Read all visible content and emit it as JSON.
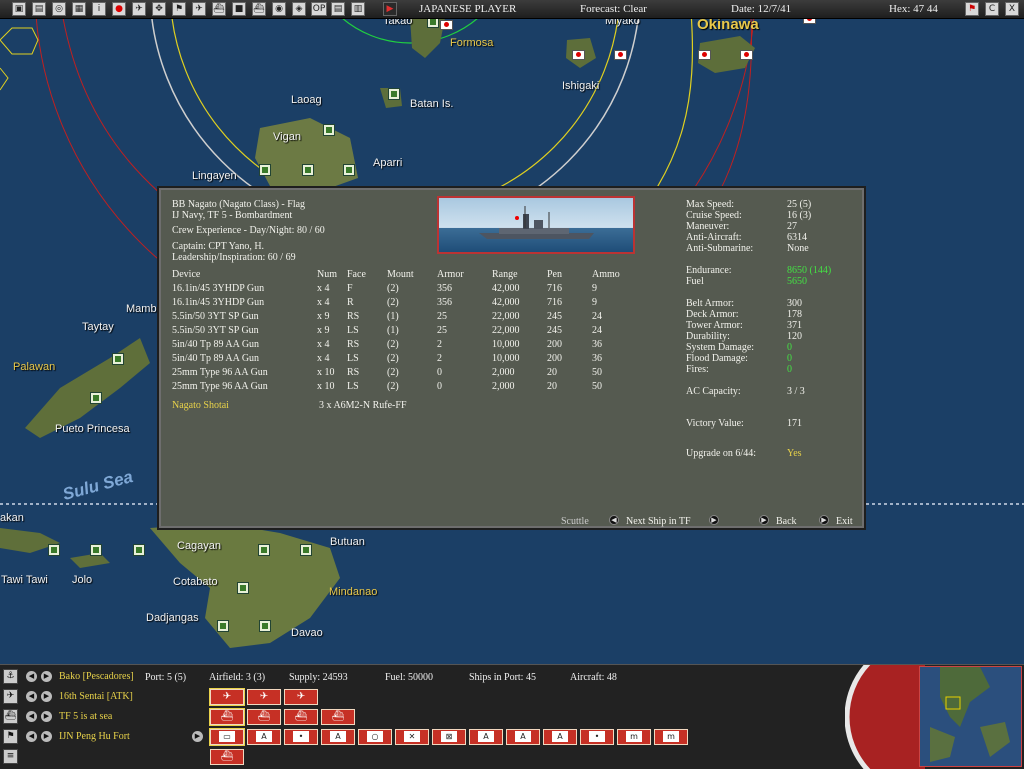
{
  "topbar": {
    "icons": [
      "home-icon",
      "document-icon",
      "cycle-icon",
      "list-icon",
      "info-icon",
      "japan-flag-icon",
      "plane-icon",
      "arrows-icon",
      "flag-icon",
      "aircraft-icon",
      "ship-icon",
      "color-swatch-icon",
      "ships-icon",
      "globe-icon",
      "radar-icon",
      "op-icon",
      "report-icon",
      "bars-icon",
      "play-icon"
    ],
    "op_label": "OP",
    "player": "JAPANESE PLAYER",
    "forecast": "Forecast: Clear",
    "date": "Date: 12/7/41",
    "hex": "Hex: 47 44",
    "right_icons": [
      "flag-icon",
      "c-icon",
      "close-icon"
    ],
    "c_label": "C",
    "close_label": "X"
  },
  "map": {
    "labels": [
      {
        "name": "label-takao",
        "text": "Takao"
      },
      {
        "name": "label-formosa",
        "text": "Formosa"
      },
      {
        "name": "label-miyako",
        "text": "Miyako"
      },
      {
        "name": "label-okinawa",
        "text": "Okinawa"
      },
      {
        "name": "label-ishigaki",
        "text": "Ishigaki"
      },
      {
        "name": "label-laoag",
        "text": "Laoag"
      },
      {
        "name": "label-batan",
        "text": "Batan Is."
      },
      {
        "name": "label-vigan",
        "text": "Vigan"
      },
      {
        "name": "label-aparri",
        "text": "Aparri"
      },
      {
        "name": "label-lingayen",
        "text": "Lingayen"
      },
      {
        "name": "label-mambu",
        "text": "Mambu"
      },
      {
        "name": "label-taytay",
        "text": "Taytay"
      },
      {
        "name": "label-palawan",
        "text": "Palawan"
      },
      {
        "name": "label-puerto-princesa",
        "text": "Pueto Princesa"
      },
      {
        "name": "label-sulu-sea",
        "text": "Sulu Sea"
      },
      {
        "name": "label-akan",
        "text": "akan"
      },
      {
        "name": "label-cagayan",
        "text": "Cagayan"
      },
      {
        "name": "label-butuan",
        "text": "Butuan"
      },
      {
        "name": "label-cotabato",
        "text": "Cotabato"
      },
      {
        "name": "label-mindanao",
        "text": "Mindanao"
      },
      {
        "name": "label-tawi-tawi",
        "text": "Tawi Tawi"
      },
      {
        "name": "label-jolo",
        "text": "Jolo"
      },
      {
        "name": "label-dadjangas",
        "text": "Dadjangas"
      },
      {
        "name": "label-davao",
        "text": "Davao"
      }
    ]
  },
  "ship": {
    "header": {
      "name": "BB Nagato (Nagato Class) - Flag",
      "fleet": "IJ Navy, TF 5 - Bombardment",
      "crew": "Crew Experience - Day/Night: 80 / 60",
      "captain": "Captain: CPT Yano, H.",
      "leadership": "Leadership/Inspiration: 60 / 69"
    },
    "columns": [
      "Device",
      "Num",
      "Face",
      "Mount",
      "Armor",
      "Range",
      "Pen",
      "Ammo"
    ],
    "devices": [
      [
        "16.1in/45 3YHDP Gun",
        "x 4",
        "F",
        "(2)",
        "356",
        "42,000",
        "716",
        "9"
      ],
      [
        "16.1in/45 3YHDP Gun",
        "x 4",
        "R",
        "(2)",
        "356",
        "42,000",
        "716",
        "9"
      ],
      [
        "5.5in/50 3YT SP Gun",
        "x 9",
        "RS",
        "(1)",
        "25",
        "22,000",
        "245",
        "24"
      ],
      [
        "5.5in/50 3YT SP Gun",
        "x 9",
        "LS",
        "(1)",
        "25",
        "22,000",
        "245",
        "24"
      ],
      [
        "5in/40 Tp 89 AA Gun",
        "x 4",
        "RS",
        "(2)",
        "2",
        "10,000",
        "200",
        "36"
      ],
      [
        "5in/40 Tp 89 AA Gun",
        "x 4",
        "LS",
        "(2)",
        "2",
        "10,000",
        "200",
        "36"
      ],
      [
        "25mm Type 96 AA Gun",
        "x 10",
        "RS",
        "(2)",
        "0",
        "2,000",
        "20",
        "50"
      ],
      [
        "25mm Type 96 AA Gun",
        "x 10",
        "LS",
        "(2)",
        "0",
        "2,000",
        "20",
        "50"
      ]
    ],
    "air_group": "Nagato Shotai",
    "air_group_aircraft": "3 x A6M2-N Rufe-FF",
    "stats": {
      "max_speed_label": "Max Speed:",
      "max_speed": "25 (5)",
      "cruise_speed_label": "Cruise Speed:",
      "cruise_speed": "16 (3)",
      "maneuver_label": "Maneuver:",
      "maneuver": "27",
      "aa_label": "Anti-Aircraft:",
      "aa": "6314",
      "asw_label": "Anti-Submarine:",
      "asw": "None",
      "endurance_label": "Endurance:",
      "endurance": "8650 (144)",
      "fuel_label": "Fuel",
      "fuel": "5650",
      "belt_label": "Belt Armor:",
      "belt": "300",
      "deck_label": "Deck Armor:",
      "deck": "178",
      "tower_label": "Tower Armor:",
      "tower": "371",
      "durability_label": "Durability:",
      "durability": "120",
      "sys_label": "System Damage:",
      "sys": "0",
      "flood_label": "Flood Damage:",
      "flood": "0",
      "fires_label": "Fires:",
      "fires": "0",
      "ac_label": "AC Capacity:",
      "ac": "3 / 3",
      "vv_label": "Victory Value:",
      "vv": "171",
      "upgrade_label": "Upgrade on 6/44:",
      "upgrade": "Yes"
    },
    "buttons": {
      "scuttle": "Scuttle",
      "next": "Next Ship in TF",
      "back": "Back",
      "exit": "Exit"
    }
  },
  "bottombar": {
    "rows": [
      {
        "icon": "base-icon",
        "label": "Bako [Pescadores]"
      },
      {
        "icon": "airgroup-icon",
        "label": "16th Sentai [ATK]"
      },
      {
        "icon": "taskforce-icon",
        "label": "TF 5 is at sea"
      },
      {
        "icon": "unit-flag-icon",
        "label": "IJN Peng Hu Fort"
      }
    ],
    "port": "Port: 5 (5)",
    "airfield": "Airfield: 3 (3)",
    "supply": "Supply: 24593",
    "fuel": "Fuel: 50000",
    "ships_in_port": "Ships in Port: 45",
    "aircraft": "Aircraft: 48",
    "air_buttons": [
      "bomber-icon",
      "fighter-icon",
      "transport-plane-icon"
    ],
    "ship_buttons": [
      "tf-ship-icon-1",
      "tf-ship-icon-2",
      "tf-ship-icon-3",
      "tf-ship-icon-4"
    ],
    "unit_buttons": [
      {
        "name": "unit-button-1",
        "sym": "▭"
      },
      {
        "name": "unit-button-2",
        "sym": "A"
      },
      {
        "name": "unit-button-3",
        "sym": "•"
      },
      {
        "name": "unit-button-4",
        "sym": "A"
      },
      {
        "name": "unit-button-5",
        "sym": "○"
      },
      {
        "name": "unit-button-6",
        "sym": "✕"
      },
      {
        "name": "unit-button-7",
        "sym": "⊠"
      },
      {
        "name": "unit-button-8",
        "sym": "A"
      },
      {
        "name": "unit-button-9",
        "sym": "A"
      },
      {
        "name": "unit-button-10",
        "sym": "A"
      },
      {
        "name": "unit-button-11",
        "sym": "•"
      },
      {
        "name": "unit-button-12",
        "sym": "m"
      },
      {
        "name": "unit-button-13",
        "sym": "m"
      }
    ],
    "extra_button": "≡"
  }
}
